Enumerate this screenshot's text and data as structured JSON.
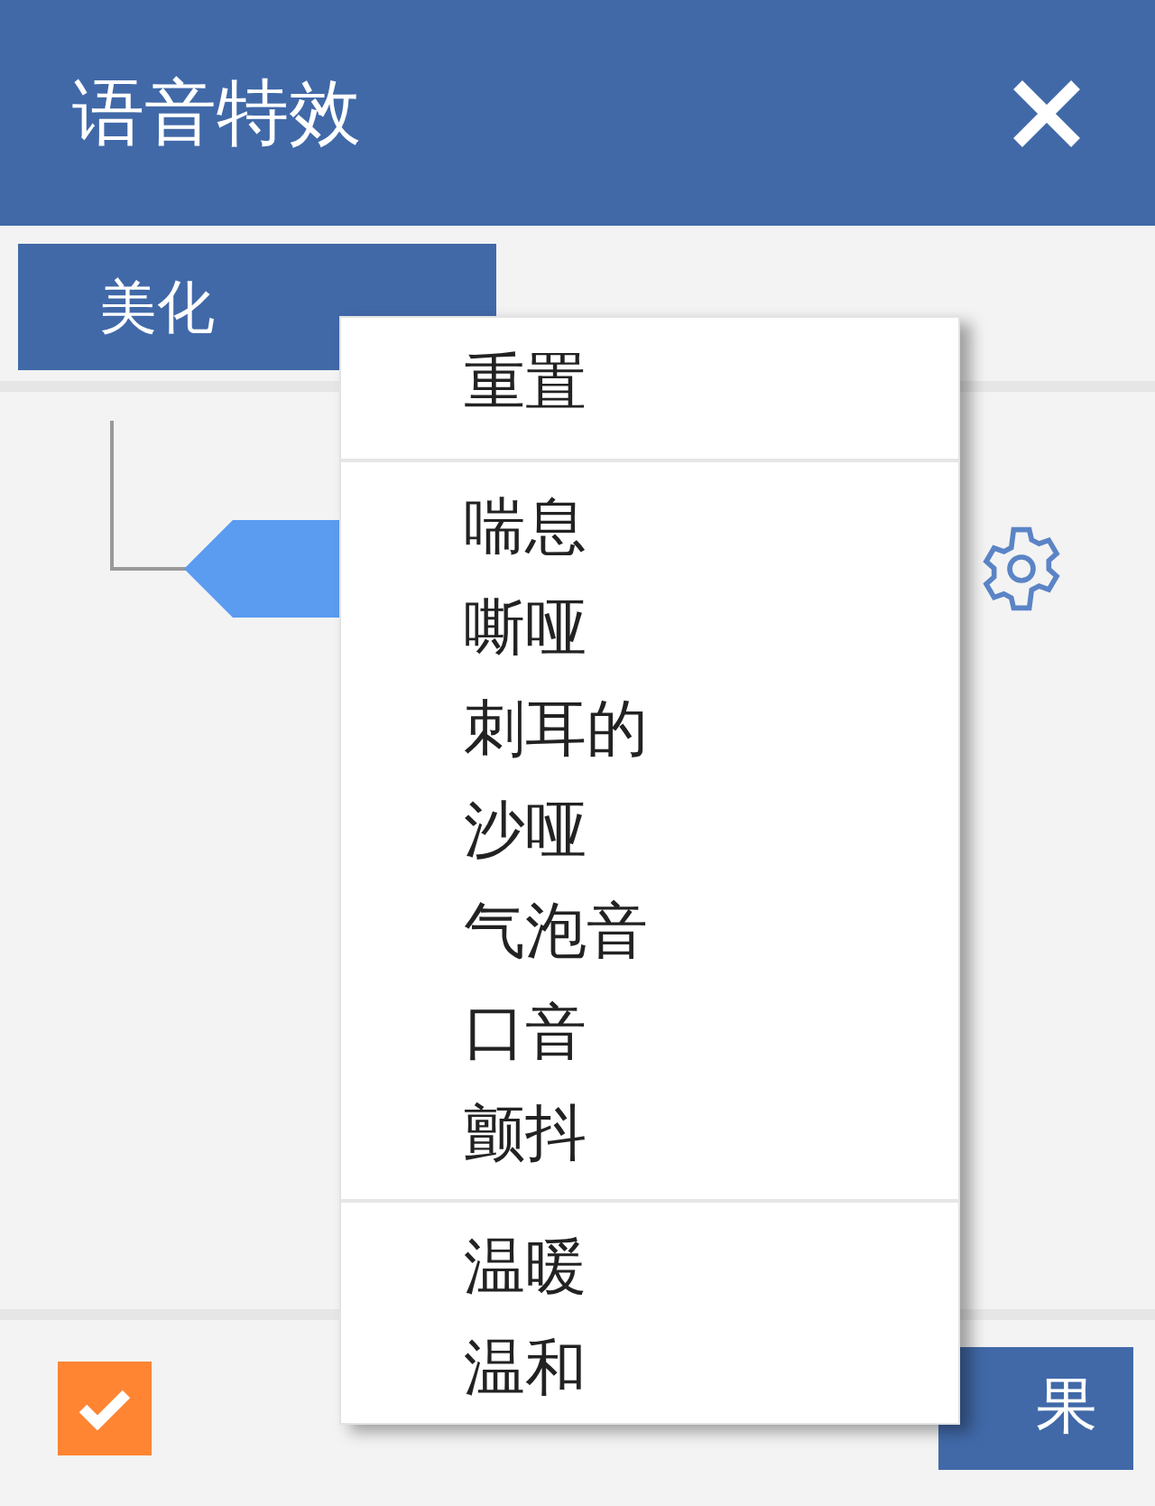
{
  "window": {
    "title": "语音特效"
  },
  "toolbar": {
    "dropdown": {
      "label": "美化",
      "expanded": true
    }
  },
  "menu": {
    "groups": [
      {
        "items": [
          "重置"
        ]
      },
      {
        "items": [
          "喘息",
          "嘶哑",
          "刺耳的",
          "沙哑",
          "气泡音",
          "口音",
          "颤抖"
        ]
      },
      {
        "items": [
          "温暖",
          "温和"
        ]
      }
    ]
  },
  "footer": {
    "checkbox": {
      "checked": true
    },
    "button": "果"
  }
}
